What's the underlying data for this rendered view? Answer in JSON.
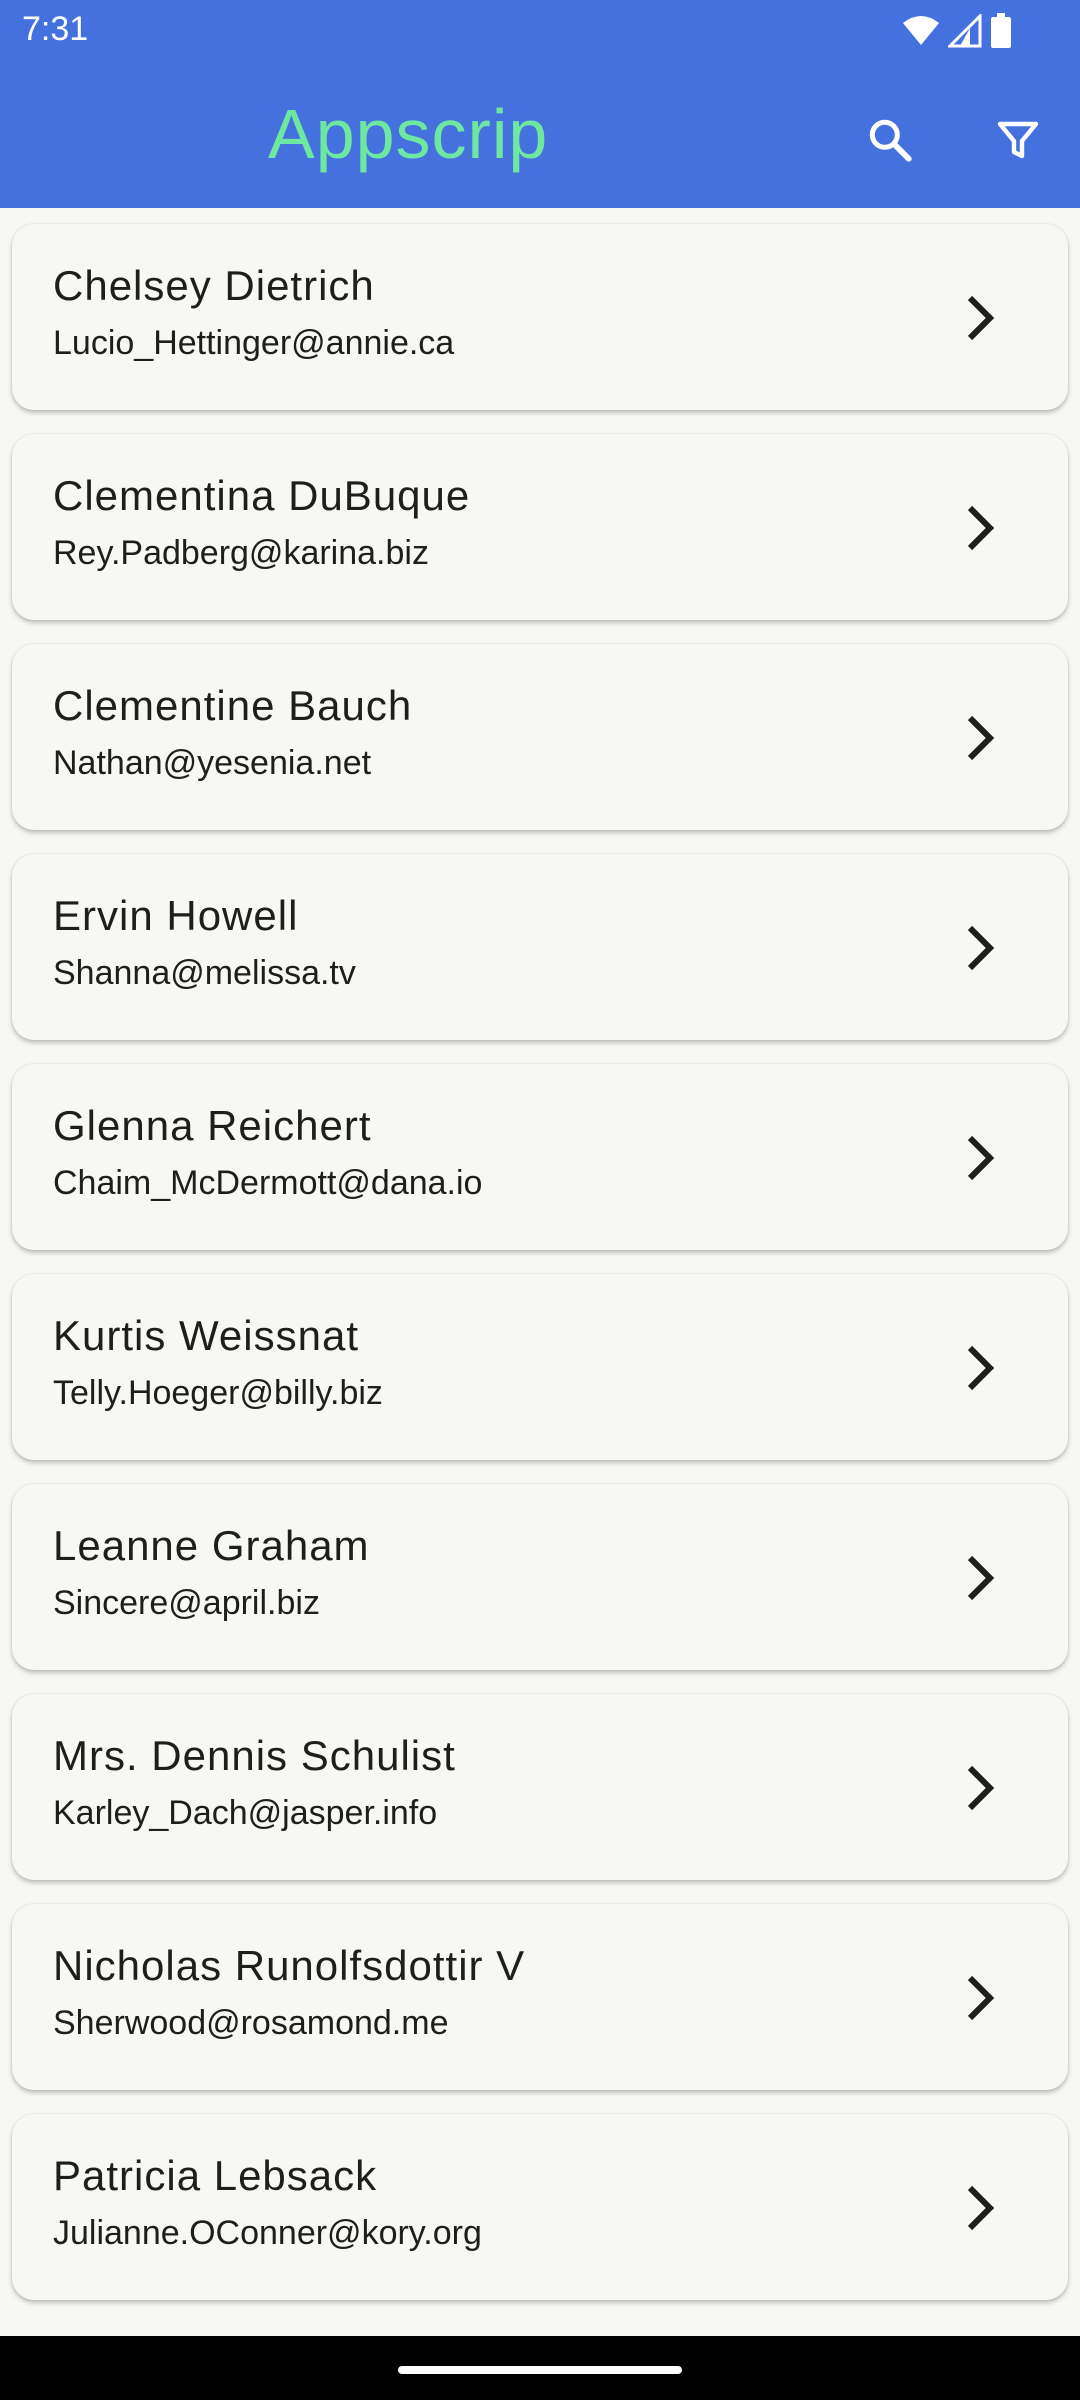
{
  "status_bar": {
    "time": "7:31"
  },
  "app_bar": {
    "title": "Appscrip",
    "title_color": "#6ee7a0",
    "background": "#4571df"
  },
  "contacts": [
    {
      "name": "Chelsey Dietrich",
      "email": "Lucio_Hettinger@annie.ca"
    },
    {
      "name": "Clementina DuBuque",
      "email": "Rey.Padberg@karina.biz"
    },
    {
      "name": "Clementine Bauch",
      "email": "Nathan@yesenia.net"
    },
    {
      "name": "Ervin Howell",
      "email": "Shanna@melissa.tv"
    },
    {
      "name": "Glenna Reichert",
      "email": "Chaim_McDermott@dana.io"
    },
    {
      "name": "Kurtis Weissnat",
      "email": "Telly.Hoeger@billy.biz"
    },
    {
      "name": "Leanne Graham",
      "email": "Sincere@april.biz"
    },
    {
      "name": "Mrs. Dennis Schulist",
      "email": "Karley_Dach@jasper.info"
    },
    {
      "name": "Nicholas Runolfsdottir V",
      "email": "Sherwood@rosamond.me"
    },
    {
      "name": "Patricia Lebsack",
      "email": "Julianne.OConner@kory.org"
    }
  ]
}
